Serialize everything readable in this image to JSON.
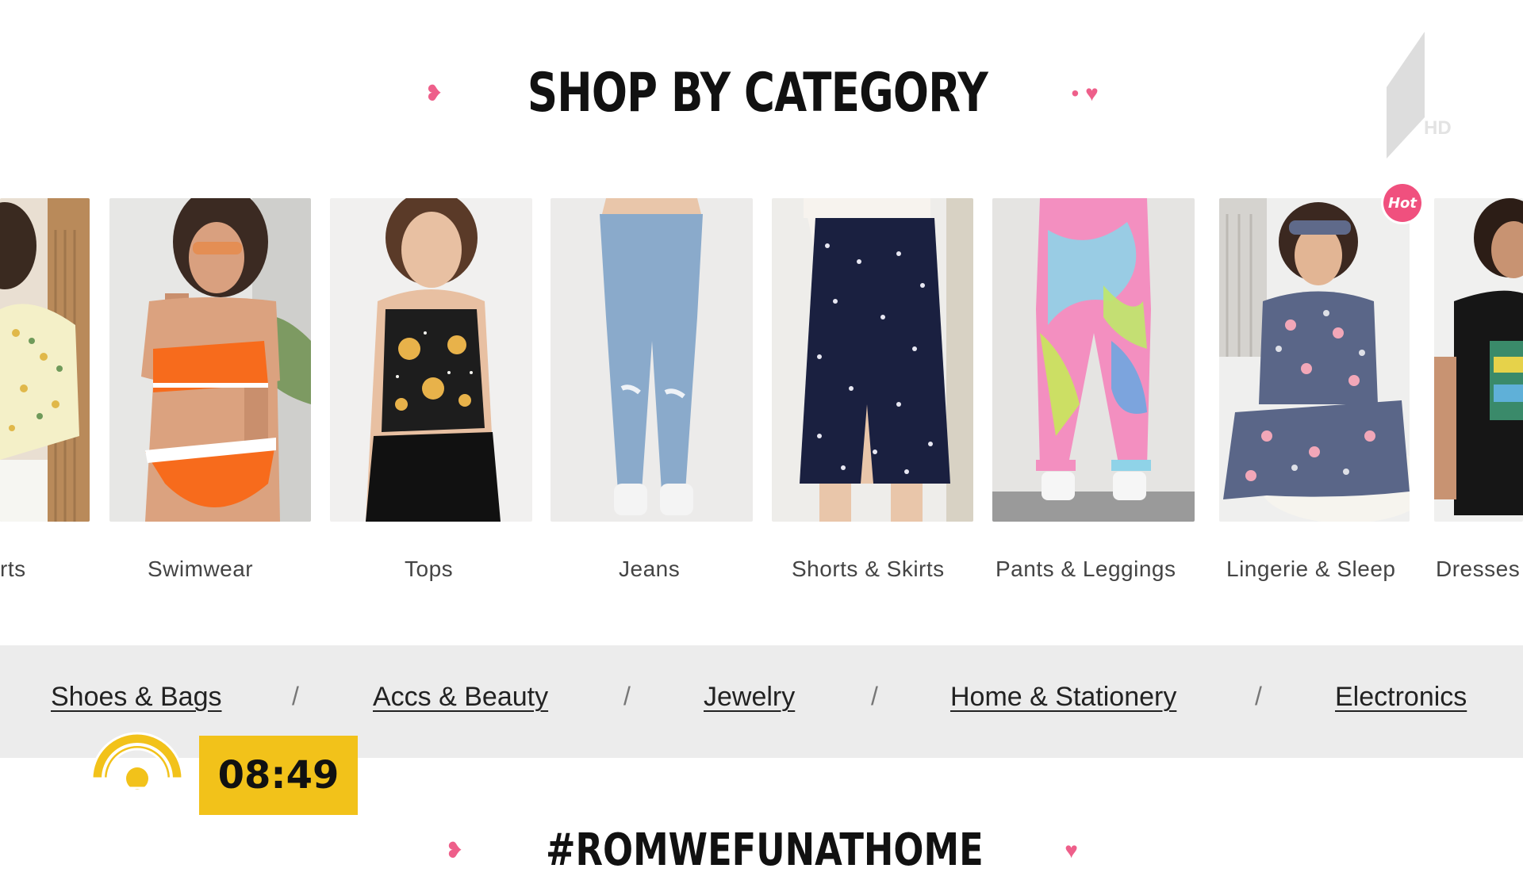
{
  "section": {
    "title": "SHOP BY CATEGORY"
  },
  "channel": {
    "badge": "HD"
  },
  "categories": [
    {
      "label": "rts",
      "alt": "Shirts"
    },
    {
      "label": "Swimwear"
    },
    {
      "label": "Tops"
    },
    {
      "label": "Jeans"
    },
    {
      "label": "Shorts & Skirts"
    },
    {
      "label": "Pants & Leggings"
    },
    {
      "label": "Lingerie & Sleep",
      "badge": "Hot"
    },
    {
      "label": "Dresses"
    }
  ],
  "subcategories": {
    "links": [
      "Shoes & Bags",
      "Accs & Beauty",
      "Jewelry",
      "Home & Stationery",
      "Electronics"
    ],
    "separator": "/"
  },
  "overlay": {
    "time": "08:49"
  },
  "bottom_section": {
    "title": "#ROMWEFUNATHOME"
  },
  "colors": {
    "accent_pink": "#ee5f8a",
    "hot_badge": "#f0507e",
    "subcat_bar": "#ececec",
    "clock_yellow": "#f2c21a"
  }
}
